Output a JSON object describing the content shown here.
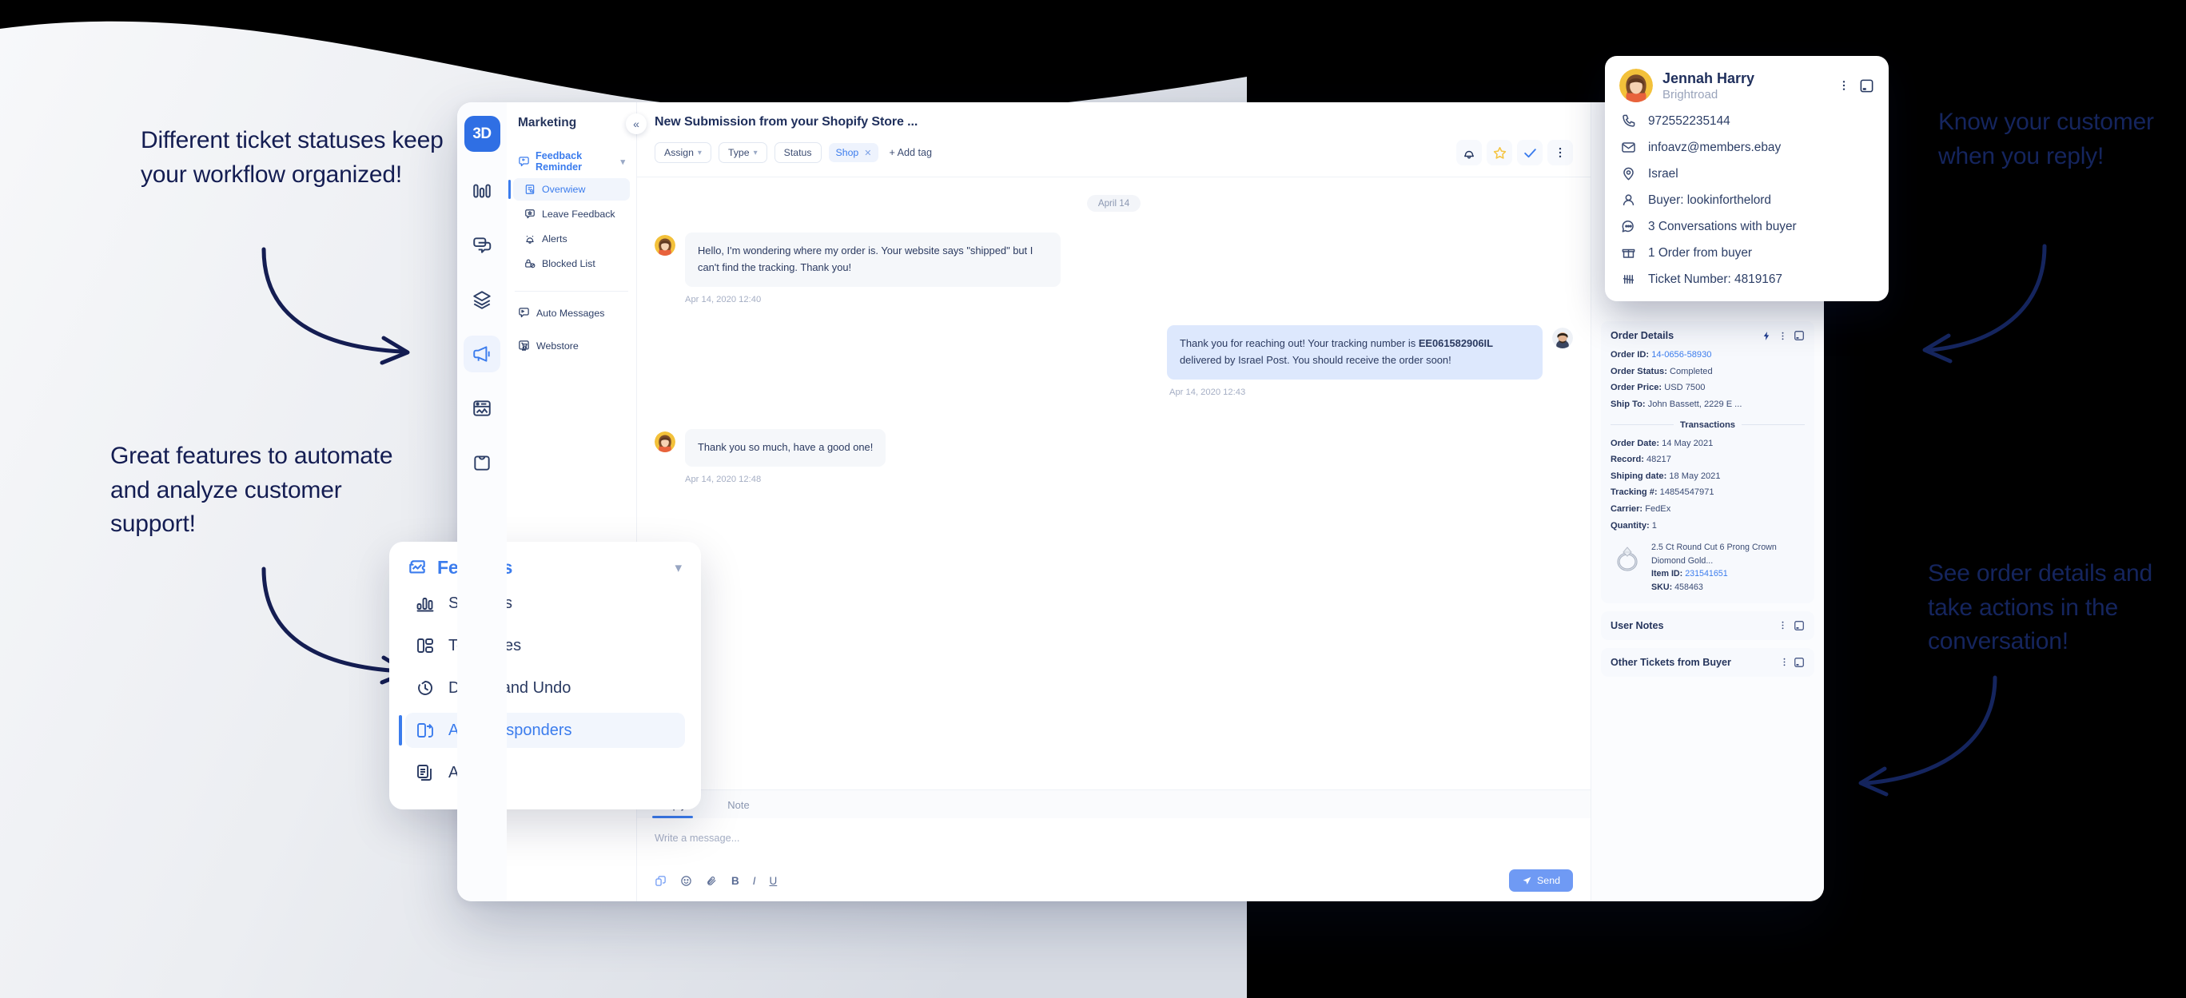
{
  "annotations": [
    {
      "id": "a1",
      "text": "Different ticket statuses keep your workflow organized!"
    },
    {
      "id": "a2",
      "text": "Great features to automate and analyze customer support!"
    },
    {
      "id": "a3",
      "text": "Know your customer when you reply!"
    },
    {
      "id": "a4",
      "text": "See order details and take actions in the conversation!"
    }
  ],
  "app": {
    "logo": "3D",
    "sidebar": {
      "title": "Marketing",
      "group": {
        "label": "Feedback Reminder",
        "icon": "feedback-icon"
      },
      "items": [
        {
          "label": "Overwiew",
          "icon": "overview-icon",
          "active": true
        },
        {
          "label": "Leave Feedback",
          "icon": "leave-feedback-icon",
          "active": false
        },
        {
          "label": "Alerts",
          "icon": "alert-bell-icon",
          "active": false
        },
        {
          "label": "Blocked List",
          "icon": "blocked-lock-icon",
          "active": false
        }
      ],
      "bottom_items": [
        {
          "label": "Auto Messages",
          "icon": "auto-message-icon"
        },
        {
          "label": "Webstore",
          "icon": "webstore-cart-icon"
        }
      ],
      "rail_icons": [
        "bar-chart-icon",
        "chat-bubbles-icon",
        "layers-icon",
        "megaphone-icon",
        "image-card-icon",
        "shopping-bag-icon"
      ]
    },
    "conversation": {
      "subject": "New Submission from your Shopify Store ...",
      "filters": [
        {
          "label": "Assign",
          "chevron": true
        },
        {
          "label": "Type",
          "chevron": true
        },
        {
          "label": "Status",
          "chevron": false
        }
      ],
      "tag": "Shop",
      "add_tag": "+ Add tag",
      "head_icons": [
        "bell-icon",
        "star-icon",
        "check-icon",
        "more-vertical-icon"
      ],
      "day_divider": "April 14",
      "messages": [
        {
          "direction": "in",
          "text": "Hello, I'm wondering where my order is. Your website says \"shipped\" but I can't find the tracking. Thank you!",
          "time": "Apr 14, 2020 12:40"
        },
        {
          "direction": "out",
          "text_before": "Thank you for reaching out! Your tracking number is ",
          "tracking": "EE061582906IL",
          "text_after": " delivered by Israel Post. You should receive the order soon!",
          "time": "Apr 14, 2020 12:43"
        },
        {
          "direction": "in",
          "text": "Thank you so much, have a good one!",
          "time": "Apr 14, 2020 12:48"
        }
      ],
      "reply": {
        "tabs": [
          {
            "label": "Reply",
            "active": true
          },
          {
            "label": "Note",
            "active": false
          }
        ],
        "placeholder": "Write a message...",
        "format_icons": [
          "link-icon",
          "emoji-icon",
          "attachment-icon",
          "bold-icon",
          "italic-icon",
          "underline-icon"
        ],
        "send_label": "Send"
      }
    },
    "detail": {
      "order_details": {
        "title": "Order Details",
        "actions": [
          "lightning-icon",
          "more-vertical-icon",
          "expand-icon"
        ],
        "fields": [
          {
            "label": "Order ID:",
            "value": "14-0656-58930",
            "link": true
          },
          {
            "label": "Order Status:",
            "value": "Completed",
            "link": false
          },
          {
            "label": "Order Price:",
            "value": "USD 7500",
            "link": false
          },
          {
            "label": "Ship To:",
            "value": "John Bassett, 2229 E ...",
            "link": false
          }
        ],
        "transactions_label": "Transactions",
        "transactions": [
          {
            "label": "Order Date:",
            "value": "14 May 2021"
          },
          {
            "label": "Record:",
            "value": "48217"
          },
          {
            "label": "Shiping date:",
            "value": "18 May 2021"
          },
          {
            "label": "Tracking #:",
            "value": "14854547971"
          },
          {
            "label": "Carrier:",
            "value": "FedEx"
          },
          {
            "label": "Quantity:",
            "value": "1"
          }
        ],
        "product": {
          "name": "2.5 Ct Round Cut 6 Prong Crown Diomond Gold...",
          "item_id_label": "Item ID:",
          "item_id": "231541651",
          "sku_label": "SKU:",
          "sku": "458463"
        }
      },
      "user_notes": {
        "title": "User Notes",
        "actions": [
          "more-vertical-icon",
          "expand-icon"
        ]
      },
      "other_tickets": {
        "title": "Other Tickets from Buyer",
        "actions": [
          "more-vertical-icon",
          "expand-icon"
        ]
      }
    },
    "contact_card": {
      "name": "Jennah Harry",
      "org": "Brightroad",
      "actions": [
        "more-vertical-icon",
        "expand-icon"
      ],
      "rows": [
        {
          "icon": "phone-icon",
          "text": "972552235144"
        },
        {
          "icon": "mail-icon",
          "text": "infoavz@members.ebay"
        },
        {
          "icon": "location-pin-icon",
          "text": "Israel"
        },
        {
          "icon": "person-icon",
          "text": "Buyer: lookinforthelord"
        },
        {
          "icon": "chat-dots-icon",
          "text": "3 Conversations with buyer"
        },
        {
          "icon": "package-icon",
          "text": "1 Order from buyer"
        },
        {
          "icon": "tally-icon",
          "text": "Ticket Number: 4819167"
        }
      ]
    },
    "features_card": {
      "title": "Features",
      "icon": "puzzle-chart-icon",
      "items": [
        {
          "label": "Statistics",
          "icon": "statistics-icon",
          "active": false
        },
        {
          "label": "Templates",
          "icon": "templates-icon",
          "active": false
        },
        {
          "label": "Delays and Undo",
          "icon": "undo-clock-icon",
          "active": false
        },
        {
          "label": "Auto Responders",
          "icon": "auto-responders-icon",
          "active": true
        },
        {
          "label": "AI",
          "icon": "ai-docs-icon",
          "active": false
        }
      ]
    }
  },
  "colors": {
    "accent": "#3b7ced",
    "logo_bg": "#2f6fe4",
    "bubble_out": "#dde8fd",
    "bubble_in": "#f5f7fa",
    "annotation": "#141d52",
    "annotation_dark": "#15255e",
    "star": "#f5c544",
    "send_button": "#6f9af4",
    "background": "#000000"
  }
}
